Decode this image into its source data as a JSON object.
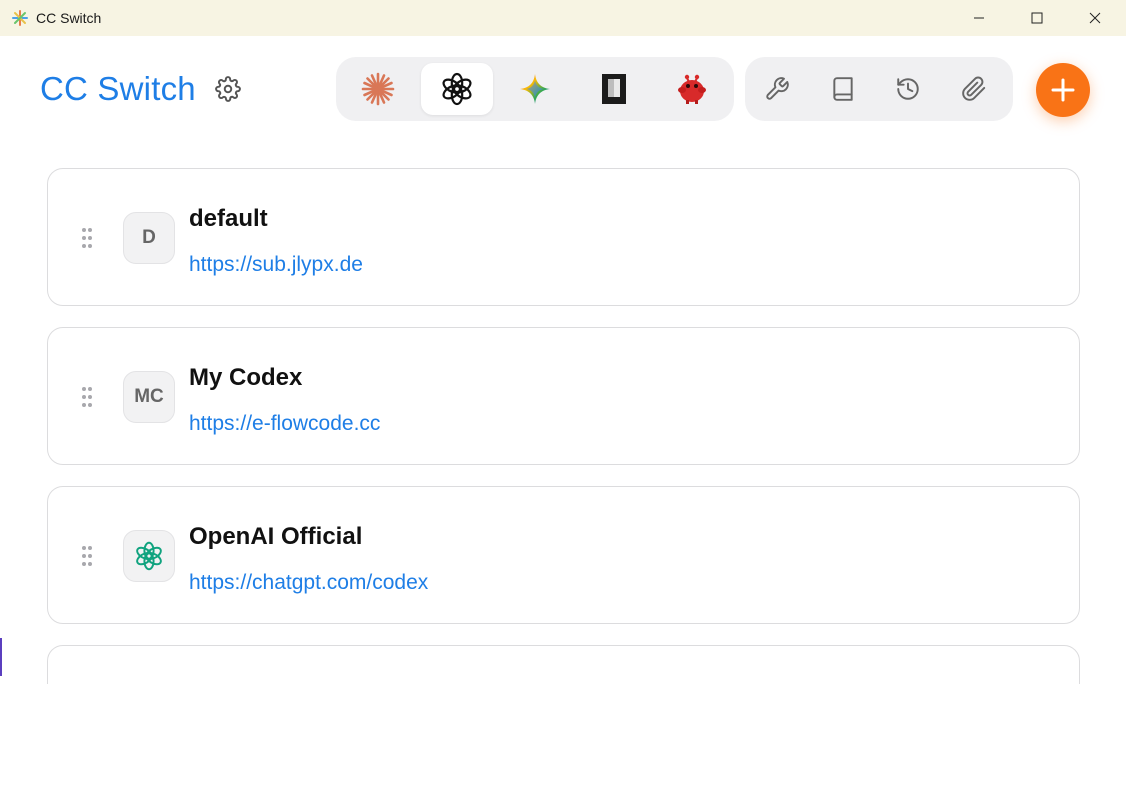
{
  "window": {
    "title": "CC Switch",
    "icons": {
      "app": "starburst-app-icon",
      "minimize": "minimize-icon",
      "maximize": "maximize-icon",
      "close": "close-icon"
    }
  },
  "header": {
    "brand": "CC Switch",
    "settings_icon": "gear-icon",
    "app_switcher": [
      {
        "name": "claude",
        "icon": "claude-starburst-icon",
        "active": false
      },
      {
        "name": "codex",
        "icon": "openai-logo-icon",
        "active": true
      },
      {
        "name": "gemini",
        "icon": "gemini-sparkle-icon",
        "active": false
      },
      {
        "name": "terminal",
        "icon": "dark-rectangle-icon",
        "active": false
      },
      {
        "name": "agent",
        "icon": "red-critter-icon",
        "active": false
      }
    ],
    "tools": [
      {
        "name": "tools",
        "icon": "wrench-icon"
      },
      {
        "name": "docs",
        "icon": "book-icon"
      },
      {
        "name": "history",
        "icon": "history-icon"
      },
      {
        "name": "attachments",
        "icon": "paperclip-icon"
      }
    ],
    "add_icon": "plus-icon"
  },
  "providers": [
    {
      "initials": "D",
      "name": "default",
      "url": "https://sub.jlypx.de"
    },
    {
      "initials": "MC",
      "name": "My Codex",
      "url": "https://e-flowcode.cc"
    },
    {
      "initials": "",
      "avatar_icon": "openai-logo-icon",
      "name": "OpenAI Official",
      "url": "https://chatgpt.com/codex"
    },
    {
      "initials": "",
      "name": "",
      "url": ""
    }
  ],
  "colors": {
    "brand": "#1e7ee6",
    "accent": "#f97316",
    "titlebar": "#f7f4e3",
    "openai_green": "#10a37f"
  }
}
